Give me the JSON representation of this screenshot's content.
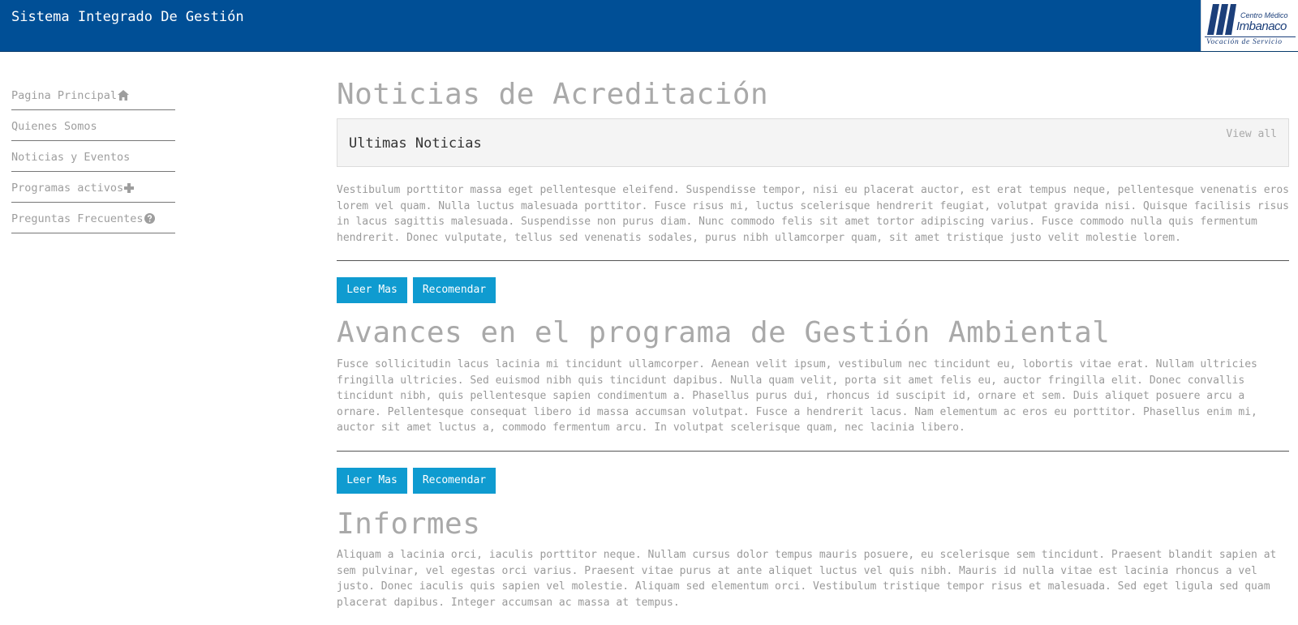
{
  "header": {
    "title": "Sistema Integrado De Gestión",
    "logo": {
      "line1": "Centro Médico",
      "line2": "Imbanaco",
      "tagline": "Vocación de Servicio"
    }
  },
  "sidebar": {
    "items": [
      {
        "label": "Pagina Principal",
        "icon": "home-icon"
      },
      {
        "label": "Quienes Somos",
        "icon": ""
      },
      {
        "label": "Noticias y Eventos",
        "icon": ""
      },
      {
        "label": "Programas activos",
        "icon": "plus-icon"
      },
      {
        "label": "Preguntas Frecuentes",
        "icon": "question-circle-icon"
      }
    ]
  },
  "main": {
    "page_title": "Noticias de Acreditación",
    "news_box": {
      "title": "Ultimas Noticias",
      "view_all": "View all"
    },
    "intro_text": "Vestibulum porttitor massa eget pellentesque eleifend. Suspendisse tempor, nisi eu placerat auctor, est erat tempus neque, pellentesque venenatis eros lorem vel quam. Nulla luctus malesuada porttitor. Fusce risus mi, luctus scelerisque hendrerit feugiat, volutpat gravida nisi. Quisque facilisis risus in lacus sagittis malesuada. Suspendisse non purus diam. Nunc commodo felis sit amet tortor adipiscing varius. Fusce commodo nulla quis fermentum hendrerit. Donec vulputate, tellus sed venenatis sodales, purus nibh ullamcorper quam, sit amet tristique justo velit molestie lorem.",
    "buttons": {
      "read_more": "Leer Mas",
      "recommend": "Recomendar"
    },
    "section2": {
      "title": "Avances en el programa de Gestión Ambiental",
      "text": "Fusce sollicitudin lacus lacinia mi tincidunt ullamcorper. Aenean velit ipsum, vestibulum nec tincidunt eu, lobortis vitae erat. Nullam ultricies fringilla ultricies. Sed euismod nibh quis tincidunt dapibus. Nulla quam velit, porta sit amet felis eu, auctor fringilla elit. Donec convallis tincidunt nibh, quis pellentesque sapien condimentum a. Phasellus purus dui, rhoncus id suscipit id, ornare et sem. Duis aliquet posuere arcu a ornare. Pellentesque consequat libero id massa accumsan volutpat. Fusce a hendrerit lacus. Nam elementum ac eros eu porttitor. Phasellus enim mi, auctor sit amet luctus a, commodo fermentum arcu. In volutpat scelerisque quam, nec lacinia libero."
    },
    "section3": {
      "title": "Informes",
      "text": "Aliquam a lacinia orci, iaculis porttitor neque. Nullam cursus dolor tempus mauris posuere, eu scelerisque sem tincidunt. Praesent blandit sapien at sem pulvinar, vel egestas orci varius. Praesent vitae purus at ante aliquet luctus vel quis nibh. Mauris id nulla vitae est lacinia rhoncus a vel justo. Donec iaculis quis sapien vel molestie. Aliquam sed elementum orci. Vestibulum tristique tempor risus et malesuada. Sed eget ligula sed quam placerat dapibus. Integer accumsan ac massa at tempus."
    }
  },
  "colors": {
    "header_bg": "#004f96",
    "button_bg": "#0f9bd0",
    "heading_text": "#a9a9a9",
    "body_text": "#9a9a9a"
  }
}
